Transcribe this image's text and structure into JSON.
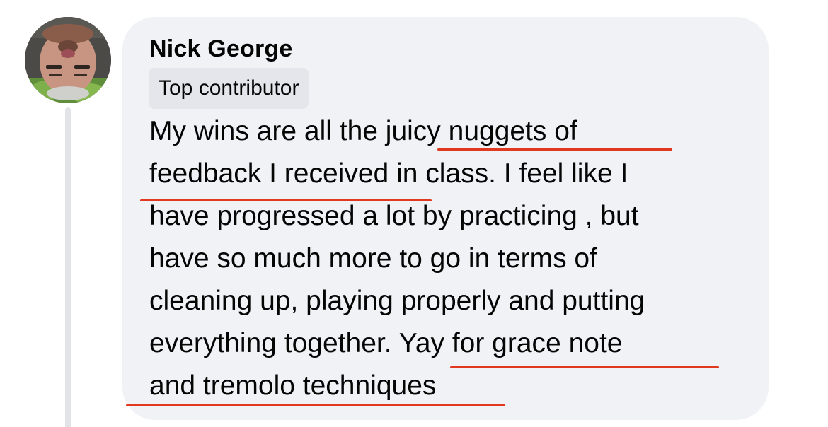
{
  "comment": {
    "author": "Nick George",
    "badge": "Top contributor",
    "lines": [
      "My wins are all the juicy nuggets of",
      "feedback I received in class. I feel like I",
      "have progressed a lot by practicing , but",
      "have so much more to go in terms of",
      "cleaning up, playing properly and putting",
      "everything together. Yay for grace note",
      "and tremolo techniques"
    ]
  },
  "colors": {
    "bubble": "#f0f2f5",
    "badge": "#e4e6eb",
    "text": "#050505",
    "annotation_underline": "#e0391f",
    "thread_line": "#e2e4e8"
  },
  "icons": {
    "avatar": "profile-photo"
  }
}
